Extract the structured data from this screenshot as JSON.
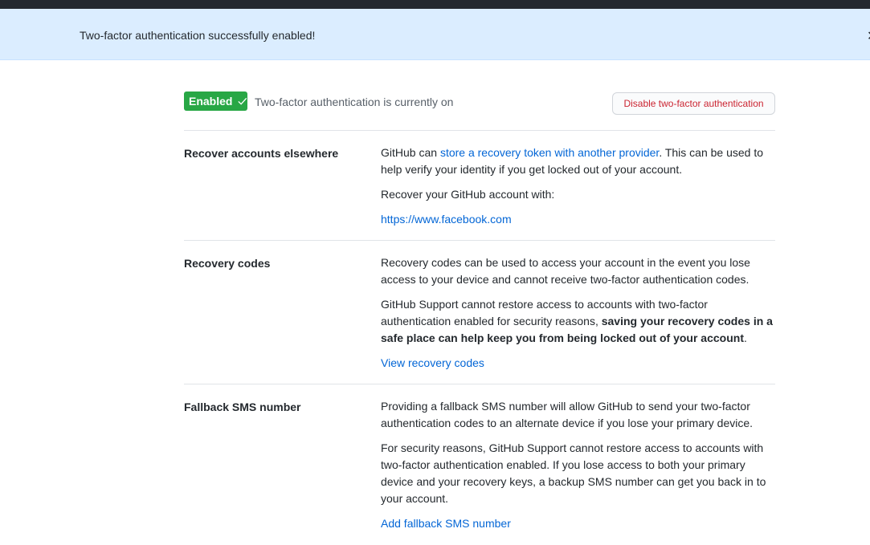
{
  "flash": {
    "message": "Two-factor authentication successfully enabled!"
  },
  "status": {
    "badge_label": "Enabled",
    "status_text": "Two-factor authentication is currently on",
    "disable_button": "Disable two-factor authentication"
  },
  "sections": {
    "recover": {
      "title": "Recover accounts elsewhere",
      "p1_prefix": "GitHub can ",
      "p1_link": "store a recovery token with another provider",
      "p1_suffix": ". This can be used to help verify your identity if you get locked out of your account.",
      "p2": "Recover your GitHub account with:",
      "provider_link": "https://www.facebook.com"
    },
    "codes": {
      "title": "Recovery codes",
      "p1": "Recovery codes can be used to access your account in the event you lose access to your device and cannot receive two-factor authentication codes.",
      "p2_prefix": "GitHub Support cannot restore access to accounts with two-factor authentication enabled for security reasons, ",
      "p2_bold": "saving your recovery codes in a safe place can help keep you from being locked out of your account",
      "p2_suffix": ".",
      "view_link": "View recovery codes"
    },
    "sms": {
      "title": "Fallback SMS number",
      "p1": "Providing a fallback SMS number will allow GitHub to send your two-factor authentication codes to an alternate device if you lose your primary device.",
      "p2": "For security reasons, GitHub Support cannot restore access to accounts with two-factor authentication enabled. If you lose access to both your primary device and your recovery keys, a backup SMS number can get you back in to your account.",
      "add_link": "Add fallback SMS number"
    }
  },
  "colors": {
    "badge_green": "#28a745",
    "link_blue": "#0366d6",
    "danger_red": "#cb2431",
    "flash_bg": "#dbedff"
  },
  "icons": {
    "badge_icon": "check-icon",
    "flash_close": "close-icon"
  }
}
